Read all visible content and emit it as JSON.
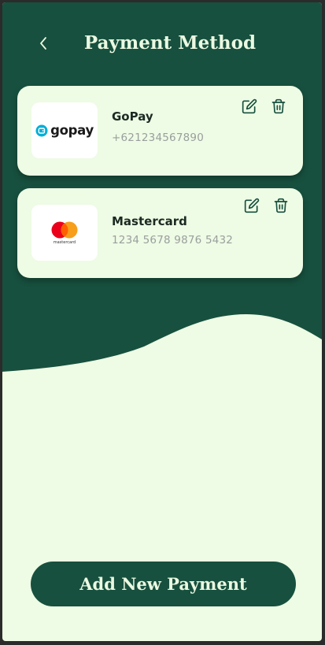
{
  "header": {
    "title": "Payment Method"
  },
  "payment_methods": [
    {
      "name": "GoPay",
      "number": "+621234567890",
      "logo_text": "gopay",
      "logo_icon": "gopay-logo"
    },
    {
      "name": "Mastercard",
      "number": "1234 5678 9876 5432",
      "logo_text": "mastercard",
      "logo_icon": "mastercard-logo"
    }
  ],
  "actions": {
    "add_label": "Add New Payment"
  },
  "icons": {
    "back": "chevron-left-icon",
    "edit": "edit-icon",
    "delete": "trash-icon"
  },
  "colors": {
    "primary_green": "#17503e",
    "light_bg": "#eefbe5",
    "title_text": "#ebf8e2",
    "card_text": "#1b2a22",
    "muted_text": "#9a9f9c"
  }
}
